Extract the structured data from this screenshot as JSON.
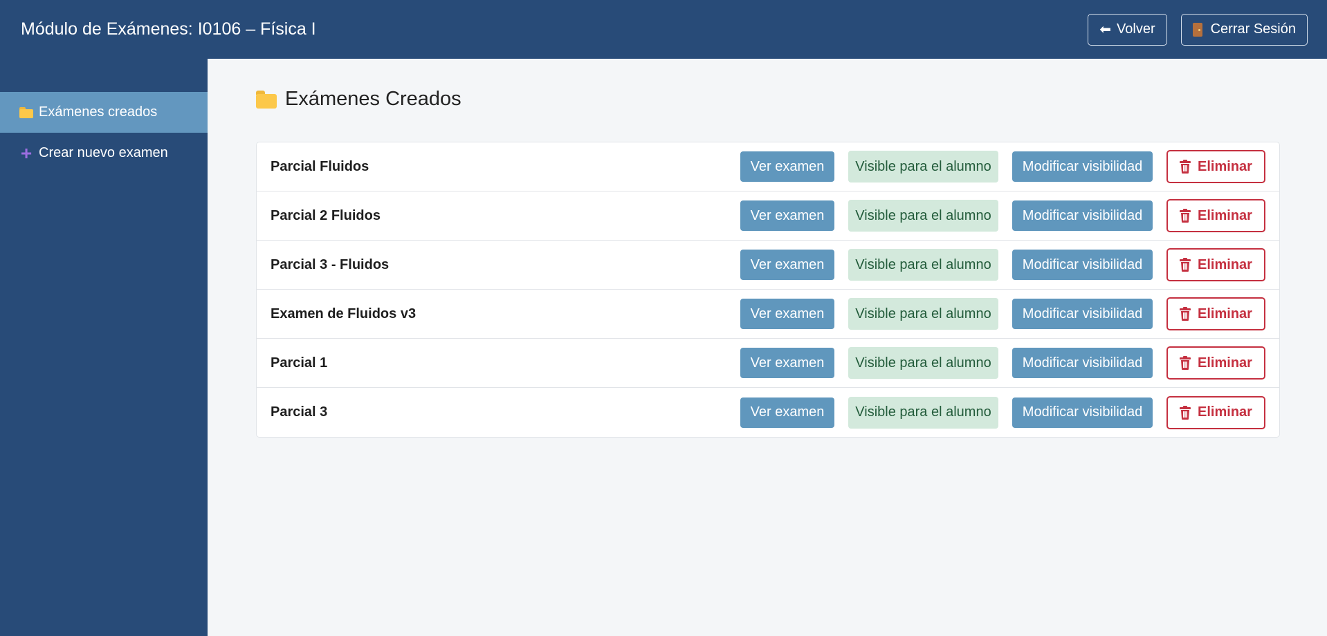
{
  "header": {
    "title": "Módulo de Exámenes: I0106 – Física I",
    "back_label": "Volver",
    "logout_label": "Cerrar Sesión"
  },
  "sidebar": {
    "items": [
      {
        "label": "Exámenes creados",
        "icon": "folder-icon",
        "active": true
      },
      {
        "label": "Crear nuevo examen",
        "icon": "plus-icon",
        "active": false
      }
    ]
  },
  "main": {
    "title": "Exámenes Creados",
    "view_label": "Ver examen",
    "visible_label": "Visible para el alumno",
    "modify_label": "Modificar visibilidad",
    "delete_label": "Eliminar",
    "exams": [
      {
        "name": "Parcial Fluidos"
      },
      {
        "name": "Parcial 2 Fluidos"
      },
      {
        "name": "Parcial 3 - Fluidos"
      },
      {
        "name": "Examen de Fluidos v3"
      },
      {
        "name": "Parcial 1"
      },
      {
        "name": "Parcial 3"
      }
    ]
  },
  "colors": {
    "header_bg": "#284b78",
    "sidebar_active": "#6397bf",
    "button_blue": "#6097bd",
    "badge_green_bg": "#d3e9dc",
    "badge_green_text": "#235c3b",
    "danger": "#c53040"
  }
}
